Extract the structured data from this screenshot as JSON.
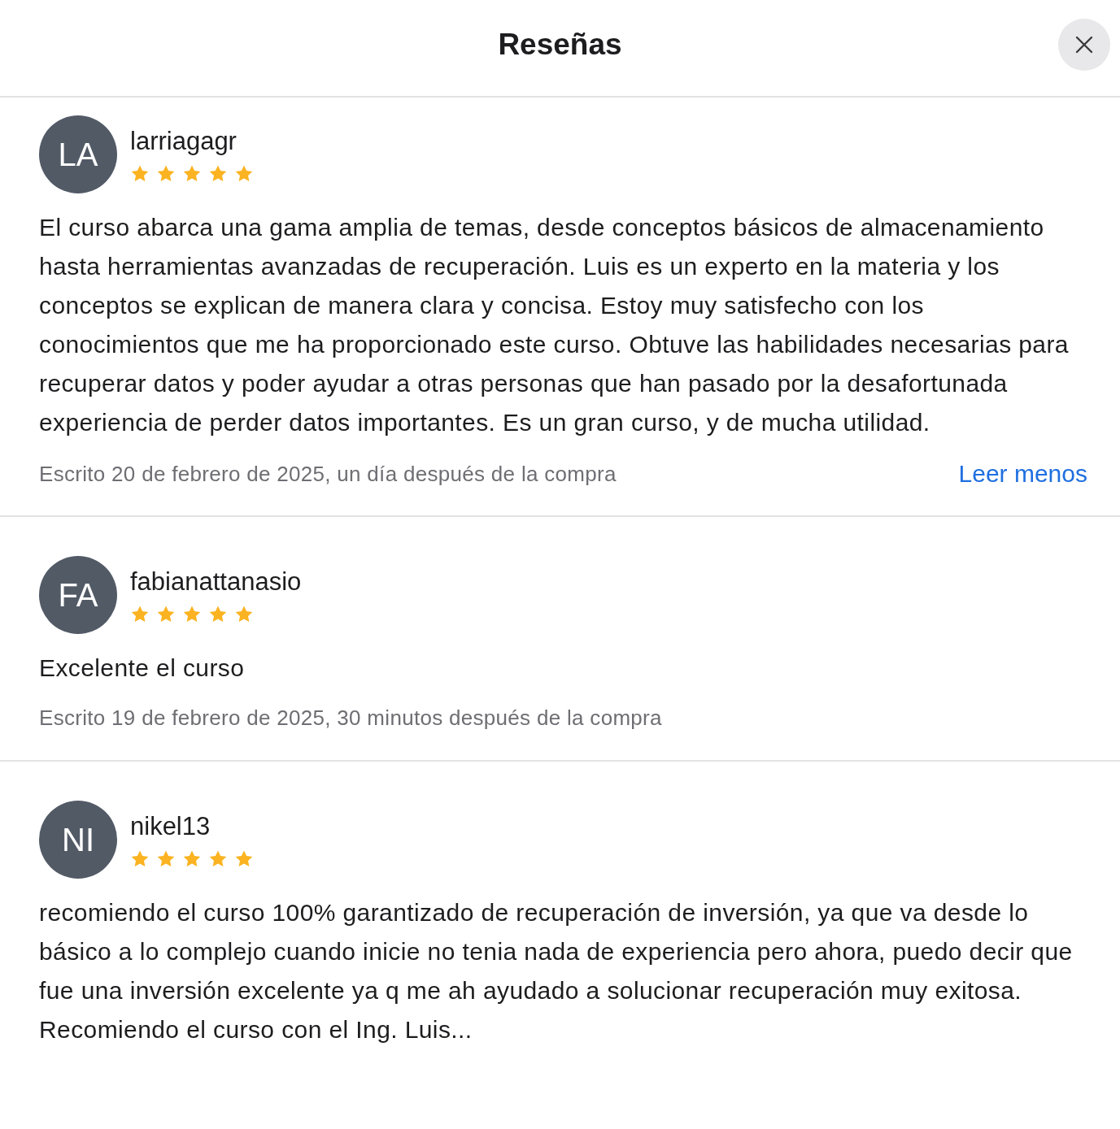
{
  "header": {
    "title": "Reseñas"
  },
  "reviews": [
    {
      "initials": "LA",
      "name": "larriagagr",
      "stars": 5,
      "text": "El curso abarca una gama amplia de temas, desde conceptos básicos de almacenamiento hasta herramientas avanzadas de recuperación. Luis es un experto en la materia y los conceptos se explican de manera clara y concisa. Estoy muy satisfecho con los conocimientos que me ha proporcionado este curso. Obtuve las habilidades necesarias para recuperar datos y poder ayudar a otras personas que han pasado por la desafortunada experiencia de perder datos importantes. Es un gran curso, y de mucha utilidad.",
      "date": "Escrito 20 de febrero de 2025, un día después de la compra",
      "link": "Leer menos"
    },
    {
      "initials": "FA",
      "name": "fabianattanasio",
      "stars": 5,
      "text": "Excelente el curso",
      "date": "Escrito 19 de febrero de 2025, 30 minutos después de la compra"
    },
    {
      "initials": "NI",
      "name": "nikel13",
      "stars": 5,
      "text": "recomiendo el curso 100% garantizado de recuperación de inversión, ya que va desde lo básico a lo complejo cuando inicie no tenia nada de experiencia pero ahora, puedo decir que fue una inversión excelente ya q me ah ayudado a solucionar recuperación muy exitosa. Recomiendo el curso con el Ing. Luis..."
    }
  ]
}
